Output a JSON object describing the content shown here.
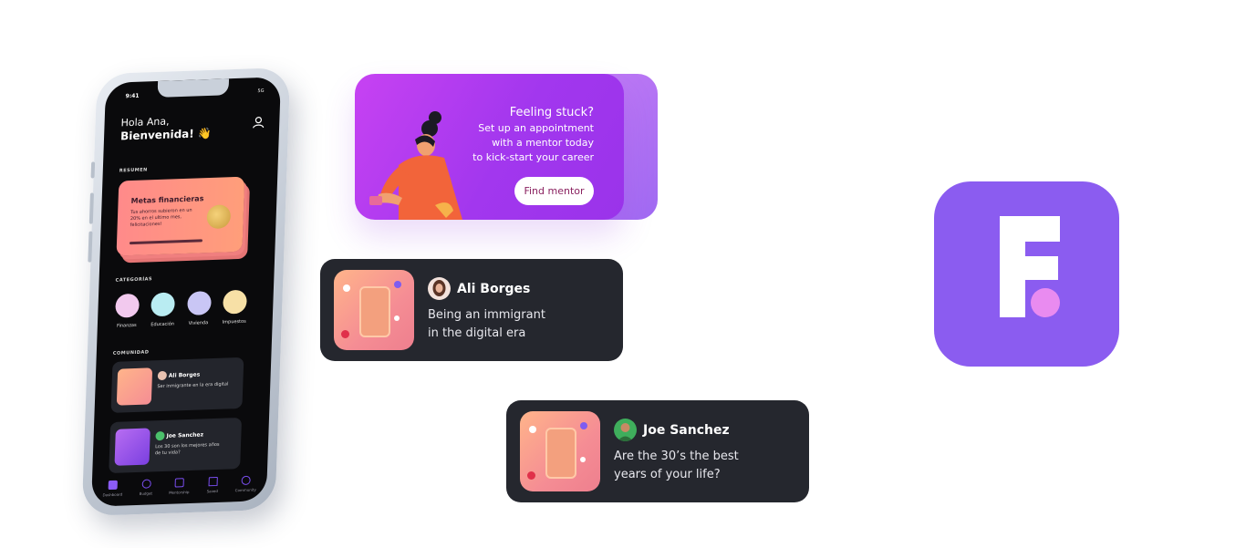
{
  "phone": {
    "status_time": "9:41",
    "status_icons": "5G",
    "greeting_line1": "Hola Ana,",
    "greeting_line2": "Bienvenida! 👋",
    "section_resumen": "RESUMEN",
    "fin_card": {
      "title": "Metas financieras",
      "body": "Tus ahorros subieron en un 20% en el ultimo mes, felicitaciones!"
    },
    "section_categorias": "CATEGORÍAS",
    "categories": [
      {
        "label": "Finanzas",
        "color": "#f2c9ee"
      },
      {
        "label": "Educación",
        "color": "#b9ecf2"
      },
      {
        "label": "Vivienda",
        "color": "#c9c6f5"
      },
      {
        "label": "Impuestos",
        "color": "#f7e0a6"
      }
    ],
    "section_comunidad": "COMUNIDAD",
    "community": [
      {
        "name": "Ali Borges",
        "text": "Ser inmigrante en la era digital"
      },
      {
        "name": "Joe Sanchez",
        "text": "Los 30 son los mejores años de tu vida?"
      }
    ],
    "tabs": [
      "Dashboard",
      "Budget",
      "Mentorship",
      "Saved",
      "Community"
    ]
  },
  "banner": {
    "title": "Feeling stuck?",
    "line1": "Set up an appointment",
    "line2": "with a mentor today",
    "line3": "to kick-start your career",
    "button": "Find mentor"
  },
  "posts": [
    {
      "name": "Ali Borges",
      "line1": "Being an immigrant",
      "line2": "in the digital era"
    },
    {
      "name": "Joe Sanchez",
      "line1": "Are the 30’s the best",
      "line2": "years of your life?"
    }
  ],
  "colors": {
    "accent": "#8b5cf0",
    "card_dark": "#25272e",
    "banner_start": "#c742f2",
    "banner_end": "#9a33ea",
    "coral": "#ff8a8a"
  },
  "icons": [
    "user-icon",
    "dashboard-icon",
    "budget-icon",
    "mentorship-icon",
    "saved-icon",
    "community-icon",
    "app-logo-icon"
  ]
}
